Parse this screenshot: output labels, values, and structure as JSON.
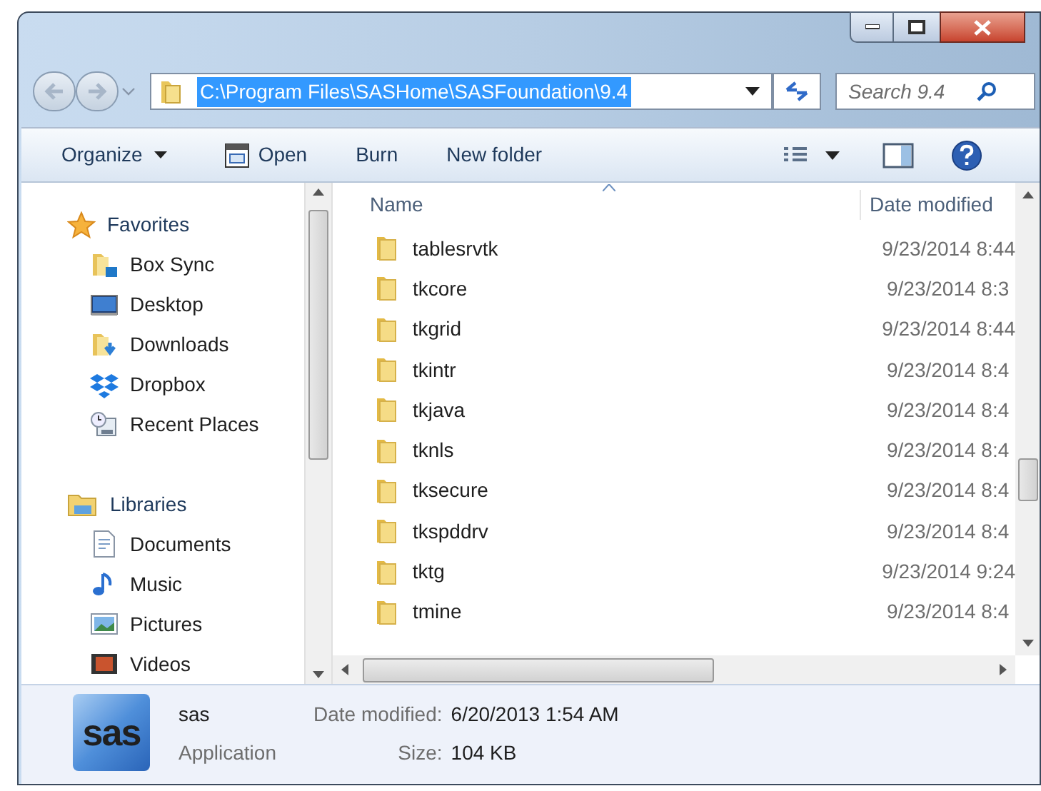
{
  "address": {
    "path": "C:\\Program Files\\SASHome\\SASFoundation\\9.4",
    "highlighted": true
  },
  "search": {
    "placeholder": "Search 9.4"
  },
  "toolbar": [
    {
      "label": "Organize",
      "kind": "menu"
    },
    {
      "label": "Open",
      "kind": "icon"
    },
    {
      "label": "Burn",
      "kind": "plain"
    },
    {
      "label": "New folder",
      "kind": "plain"
    }
  ],
  "nav": [
    {
      "label": "Favorites",
      "kind": "star",
      "children": [
        {
          "label": "Box Sync",
          "kind": "box"
        },
        {
          "label": "Desktop",
          "kind": "desktop"
        },
        {
          "label": "Downloads",
          "kind": "downloads"
        },
        {
          "label": "Dropbox",
          "kind": "dropbox"
        },
        {
          "label": "Recent Places",
          "kind": "recent"
        }
      ]
    },
    {
      "label": "Libraries",
      "kind": "library",
      "children": [
        {
          "label": "Documents",
          "kind": "documents"
        },
        {
          "label": "Music",
          "kind": "music"
        },
        {
          "label": "Pictures",
          "kind": "pictures"
        },
        {
          "label": "Videos",
          "kind": "videos"
        }
      ]
    }
  ],
  "columns": [
    "Name",
    "Date modified"
  ],
  "rows": [
    {
      "name": "tablesrvtk",
      "date": "9/23/2014 8:44"
    },
    {
      "name": "tkcore",
      "date": "9/23/2014 8:3"
    },
    {
      "name": "tkgrid",
      "date": "9/23/2014 8:44"
    },
    {
      "name": "tkintr",
      "date": "9/23/2014 8:4"
    },
    {
      "name": "tkjava",
      "date": "9/23/2014 8:4"
    },
    {
      "name": "tknls",
      "date": "9/23/2014 8:4"
    },
    {
      "name": "tksecure",
      "date": "9/23/2014 8:4"
    },
    {
      "name": "tkspddrv",
      "date": "9/23/2014 8:4"
    },
    {
      "name": "tktg",
      "date": "9/23/2014 9:24"
    },
    {
      "name": "tmine",
      "date": "9/23/2014 8:4"
    }
  ],
  "details": {
    "logo": "sas",
    "name": "sas",
    "type": "Application",
    "fields": [
      {
        "label": "Date modified:",
        "value": "6/20/2013 1:54 AM"
      },
      {
        "label": "Size:",
        "value": "104 KB"
      }
    ]
  }
}
